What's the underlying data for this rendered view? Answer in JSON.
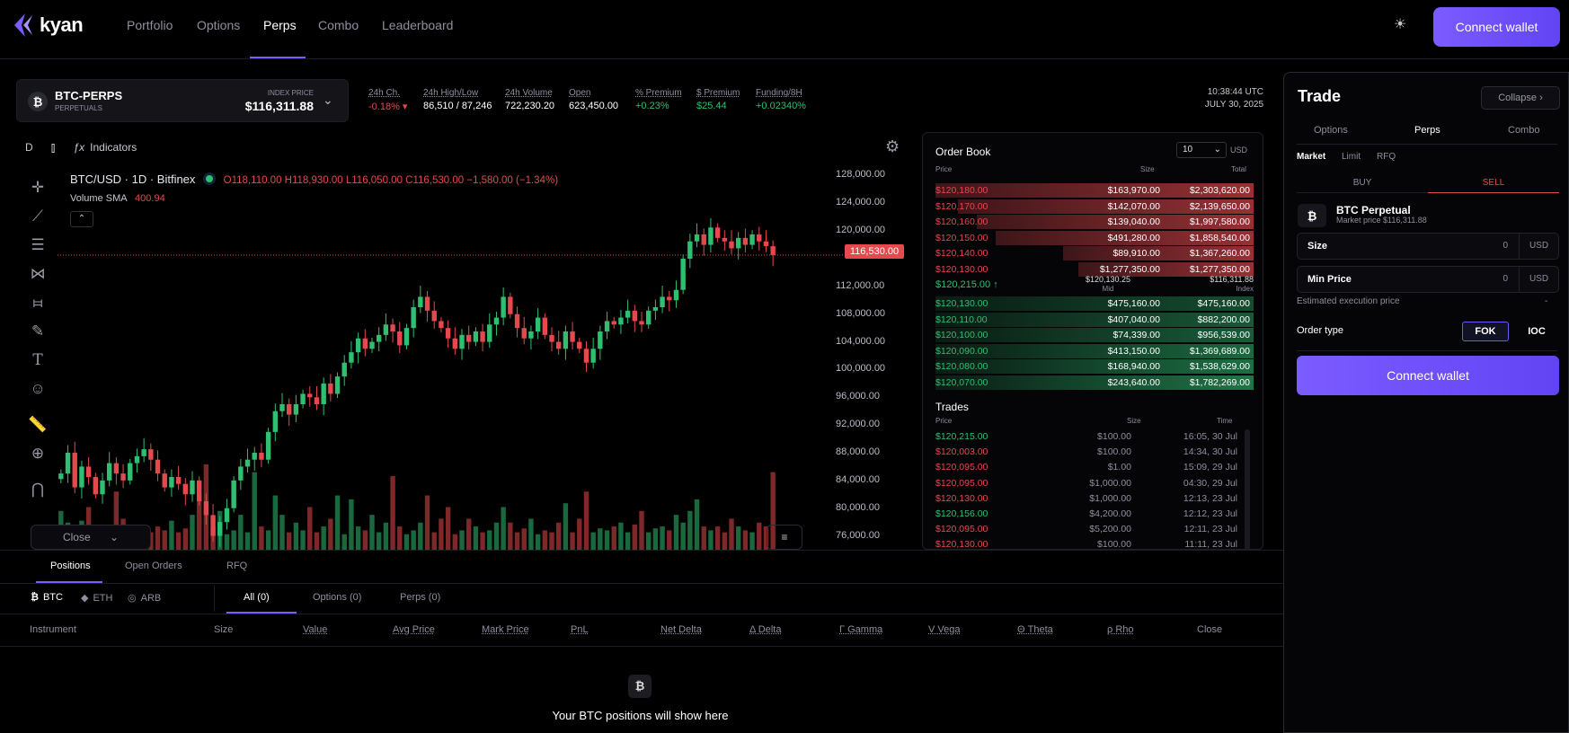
{
  "brand": {
    "name": "kyan",
    "color": "#7b5cff"
  },
  "nav": {
    "items": [
      "Portfolio",
      "Options",
      "Perps",
      "Combo",
      "Leaderboard"
    ],
    "active": "Perps",
    "connect_wallet": "Connect wallet"
  },
  "market": {
    "symbol": "BTC-PERPS",
    "subtitle": "PERPETUALS",
    "index_price_label": "INDEX PRICE",
    "index_price": "$116,311.88",
    "coin_glyph": "₿"
  },
  "stats": [
    {
      "label": "24h Ch.",
      "value": "-0.18% ▾",
      "tone": "red"
    },
    {
      "label": "24h High/Low",
      "value": "86,510 / 87,246",
      "tone": "white"
    },
    {
      "label": "24h Volume",
      "value": "722,230.20",
      "tone": "white"
    },
    {
      "label": "Open",
      "value": "623,450.00",
      "tone": "white"
    },
    {
      "label": "% Premium",
      "value": "+0.23%",
      "tone": "green"
    },
    {
      "label": "$ Premium",
      "value": "$25.44",
      "tone": "green"
    },
    {
      "label": "Funding/8H",
      "value": "+0.02340%",
      "tone": "green"
    }
  ],
  "clock": {
    "time": "10:38:44 UTC",
    "date": "JULY 30, 2025"
  },
  "chart": {
    "interval": "D",
    "indicators_label": "Indicators",
    "legend_symbol": "BTC/USD · 1D · Bitfinex",
    "ohlc": "O118,110.00 H118,930.00 L116,050.00 C116,530.00 −1,580.00 (−1.34%)",
    "volume_label": "Volume SMA",
    "volume_value": "400.94",
    "last_price": "116,530.00",
    "close_label": "Close",
    "price_ticks": [
      "128,000.00",
      "124,000.00",
      "120,000.00",
      "112,000.00",
      "108,000.00",
      "104,000.00",
      "100,000.00",
      "96,000.00",
      "92,000.00",
      "88,000.00",
      "84,000.00",
      "80,000.00",
      "76,000.00"
    ],
    "tools": [
      "crosshair-icon",
      "trendline-icon",
      "fib-icon",
      "pattern-icon",
      "projection-icon",
      "brush-icon",
      "text-icon",
      "emoji-icon",
      "ruler-icon",
      "zoom-icon",
      "magnet-icon"
    ]
  },
  "chart_data": {
    "type": "candlestick",
    "symbol": "BTC/USD",
    "interval": "1D",
    "ylim": [
      74000,
      130000
    ],
    "closes": [
      85000,
      88000,
      83000,
      86000,
      84500,
      82000,
      84000,
      86500,
      85000,
      84000,
      86500,
      87500,
      88500,
      87000,
      85000,
      83000,
      84500,
      83500,
      82000,
      84000,
      81000,
      79000,
      76000,
      78000,
      80000,
      84000,
      86000,
      87000,
      88000,
      87000,
      91000,
      94000,
      95000,
      93500,
      95000,
      96500,
      96000,
      95000,
      98000,
      96500,
      99000,
      101000,
      102500,
      104500,
      103000,
      104000,
      105000,
      106500,
      105500,
      103500,
      106000,
      109000,
      110500,
      108500,
      107000,
      106000,
      104500,
      103000,
      105000,
      104000,
      105500,
      104000,
      106500,
      107500,
      110500,
      108000,
      106000,
      104500,
      105500,
      107500,
      105000,
      104000,
      103000,
      105500,
      104000,
      103000,
      101000,
      103000,
      105500,
      107000,
      106500,
      107500,
      108500,
      107000,
      106500,
      108500,
      109000,
      110500,
      110000,
      111500,
      116000,
      118500,
      119500,
      118000,
      120500,
      119000,
      118500,
      117500,
      119000,
      118000,
      119500,
      118500,
      117800,
      116530
    ],
    "volumes": [
      20,
      14,
      10,
      15,
      22,
      10,
      8,
      12,
      30,
      16,
      10,
      8,
      13,
      9,
      12,
      10,
      15,
      9,
      11,
      18,
      26,
      44,
      12,
      20,
      8,
      10,
      18,
      9,
      40,
      12,
      10,
      28,
      18,
      9,
      14,
      10,
      22,
      9,
      12,
      16,
      28,
      8,
      26,
      12,
      10,
      18,
      9,
      14,
      38,
      12,
      8,
      10,
      14,
      28,
      9,
      16,
      22,
      8,
      10,
      16,
      12,
      9,
      10,
      14,
      22,
      14,
      9,
      11,
      16,
      8,
      10,
      9,
      14,
      24,
      9,
      16,
      30,
      9,
      11,
      10,
      12,
      14,
      9,
      13,
      20,
      9,
      11,
      12,
      10,
      18,
      14,
      20,
      26,
      12,
      10,
      12,
      9,
      16,
      12,
      10,
      9,
      14,
      12,
      40
    ]
  },
  "orderbook": {
    "title": "Order Book",
    "depth": "10",
    "unit": "USD",
    "headers": {
      "price": "Price",
      "size": "Size",
      "total": "Total"
    },
    "asks": [
      {
        "price": "$120,180.00",
        "size": "$163,970.00",
        "total": "$2,303,620.00",
        "depth": 1.0
      },
      {
        "price": "$120,170.00",
        "size": "$142,070.00",
        "total": "$2,139,650.00",
        "depth": 0.93
      },
      {
        "price": "$120,160.00",
        "size": "$139,040.00",
        "total": "$1,997,580.00",
        "depth": 0.87
      },
      {
        "price": "$120,150.00",
        "size": "$491,280.00",
        "total": "$1,858,540.00",
        "depth": 0.81
      },
      {
        "price": "$120,140.00",
        "size": "$89,910.00",
        "total": "$1,367,260.00",
        "depth": 0.6
      },
      {
        "price": "$120,130.00",
        "size": "$1,277,350.00",
        "total": "$1,277,350.00",
        "depth": 0.55
      }
    ],
    "mid": {
      "last": "$120,215.00 ↑",
      "mid_value": "$120,130.25",
      "mid_label": "Mid",
      "index_value": "$116,311.88",
      "index_label": "Index"
    },
    "bids": [
      {
        "price": "$120,130.00",
        "size": "$475,160.00",
        "total": "$475,160.00",
        "depth": 0.21
      },
      {
        "price": "$120,110.00",
        "size": "$407,040.00",
        "total": "$882,200.00",
        "depth": 0.38
      },
      {
        "price": "$120,100.00",
        "size": "$74,339.00",
        "total": "$956,539.00",
        "depth": 0.42
      },
      {
        "price": "$120,090.00",
        "size": "$413,150.00",
        "total": "$1,369,689.00",
        "depth": 0.59
      },
      {
        "price": "$120,080.00",
        "size": "$168,940.00",
        "total": "$1,538,629.00",
        "depth": 0.67
      },
      {
        "price": "$120,070.00",
        "size": "$243,640.00",
        "total": "$1,782,269.00",
        "depth": 0.77
      }
    ]
  },
  "trades": {
    "title": "Trades",
    "headers": {
      "price": "Price",
      "size": "Size",
      "time": "Time"
    },
    "rows": [
      {
        "price": "$120,215.00",
        "size": "$100.00",
        "time": "16:05, 30 Jul",
        "side": "buy"
      },
      {
        "price": "$120,003.00",
        "size": "$100.00",
        "time": "14:34, 30 Jul",
        "side": "sell"
      },
      {
        "price": "$120,095.00",
        "size": "$1.00",
        "time": "15:09, 29 Jul",
        "side": "sell"
      },
      {
        "price": "$120,095.00",
        "size": "$1,000.00",
        "time": "04:30, 29 Jul",
        "side": "sell"
      },
      {
        "price": "$120,130.00",
        "size": "$1,000.00",
        "time": "12:13, 23 Jul",
        "side": "sell"
      },
      {
        "price": "$120,156.00",
        "size": "$4,200.00",
        "time": "12:12, 23 Jul",
        "side": "buy"
      },
      {
        "price": "$120,095.00",
        "size": "$5,200.00",
        "time": "12:11, 23 Jul",
        "side": "sell"
      },
      {
        "price": "$120,130.00",
        "size": "$100.00",
        "time": "11:11, 23 Jul",
        "side": "sell"
      }
    ]
  },
  "positions": {
    "tabs": [
      "Positions",
      "Open Orders",
      "RFQ"
    ],
    "assets": [
      {
        "label": "BTC",
        "glyph": "₿"
      },
      {
        "label": "ETH",
        "glyph": "◆"
      },
      {
        "label": "ARB",
        "glyph": "◎"
      }
    ],
    "filters": [
      "All (0)",
      "Options (0)",
      "Perps (0)"
    ],
    "columns": [
      "Instrument",
      "Size",
      "Value",
      "Avg Price",
      "Mark Price",
      "PnL",
      "Net Delta",
      "Δ Delta",
      "Γ Gamma",
      "V Vega",
      "Θ Theta",
      "ρ Rho",
      "Close"
    ],
    "empty_message": "Your BTC positions will show here"
  },
  "trade_panel": {
    "title": "Trade",
    "collapse": "Collapse ›",
    "tabs": [
      "Options",
      "Perps",
      "Combo"
    ],
    "order_tabs": [
      "Market",
      "Limit",
      "RFQ"
    ],
    "buy": "BUY",
    "sell": "SELL",
    "instrument": "BTC Perpetual",
    "market_price": "Market price $116,311.88",
    "size_label": "Size",
    "size_value": "0",
    "size_unit": "USD",
    "min_price_label": "Min Price",
    "min_price_value": "0",
    "min_price_unit": "USD",
    "est_label": "Estimated execution price",
    "est_value": "-",
    "order_type_label": "Order type",
    "order_types": [
      "FOK",
      "IOC"
    ],
    "connect_wallet": "Connect wallet"
  },
  "colors": {
    "up": "#2fbf71",
    "down": "#e5484d",
    "accent": "#7b5cff"
  }
}
